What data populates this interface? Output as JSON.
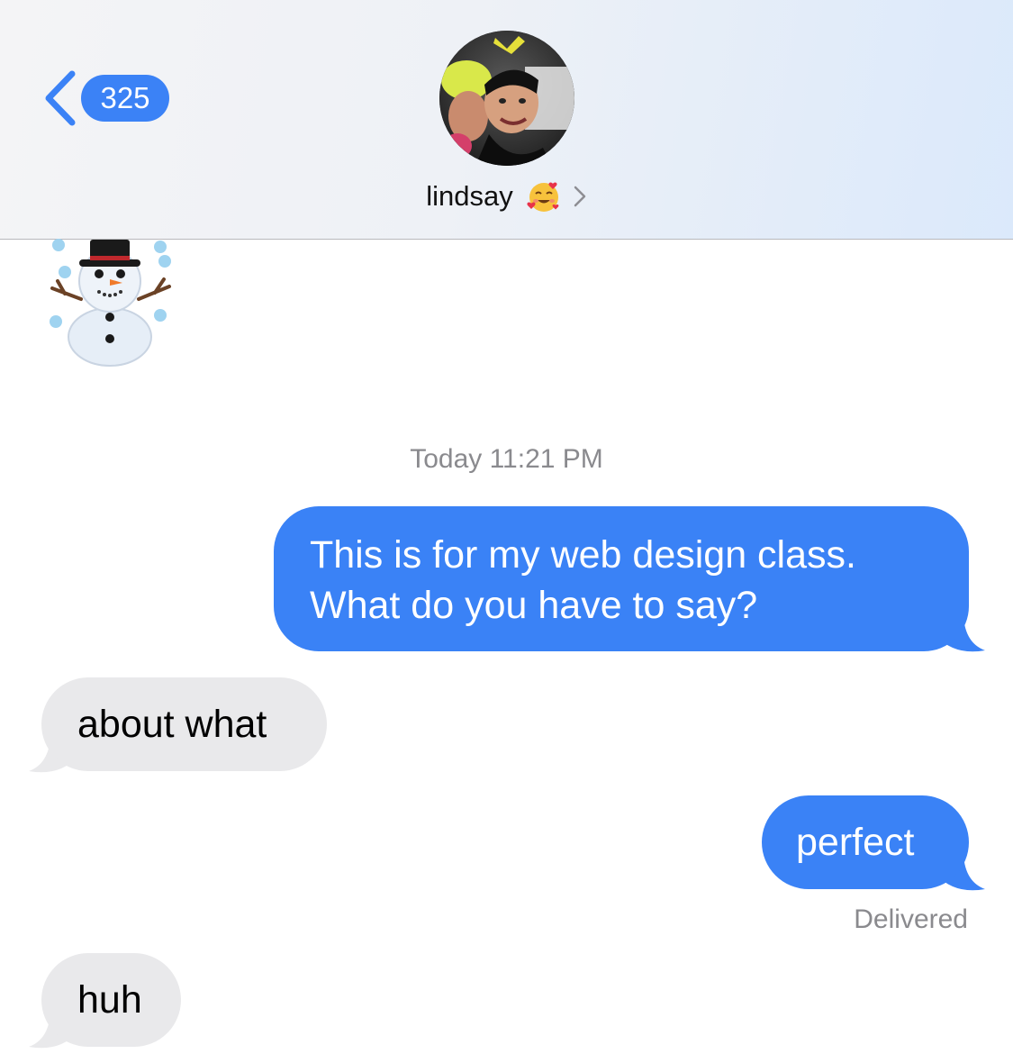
{
  "header": {
    "back_count": "325",
    "contact_name": "lindsay",
    "contact_emoji": "smiling-face-with-hearts",
    "accent_color": "#3b82f6"
  },
  "conversation": {
    "first_message_emoji": "snowman-with-snow",
    "timestamp": "Today 11:21 PM",
    "messages": [
      {
        "direction": "sent",
        "lines": [
          "This is for my web design class.",
          "What do you have to say?"
        ]
      },
      {
        "direction": "received",
        "text": "about what"
      },
      {
        "direction": "sent",
        "text": "perfect"
      },
      {
        "direction": "received",
        "text": "huh"
      }
    ],
    "status": "Delivered"
  },
  "colors": {
    "sent_bubble": "#3a82f6",
    "received_bubble": "#e9e9eb",
    "meta_text": "#8a8a8e"
  }
}
